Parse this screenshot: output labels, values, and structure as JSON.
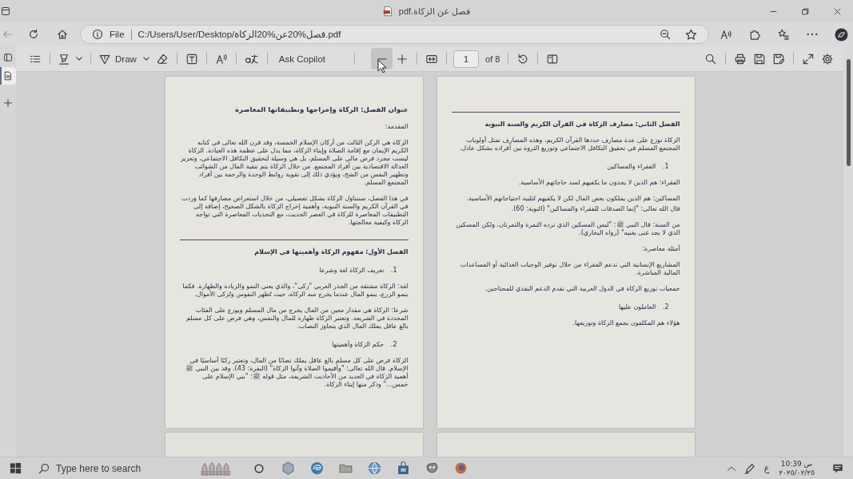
{
  "window": {
    "title": "فصل عن الزكاة.pdf"
  },
  "vertical_tabs": [
    {
      "selected": true
    }
  ],
  "address_bar": {
    "scheme": "File",
    "url": "C:/Users/User/Desktop/فصل%20عن%20الزكاة.pdf"
  },
  "pdf_toolbar": {
    "draw_label": "Draw",
    "ask_label": "Ask Copilot",
    "zoom_out_hovered": true,
    "page_number": "1",
    "page_count": "of 8"
  },
  "pages": [
    {
      "blocks": [
        {
          "kind": "title",
          "text": "عنوان الفصل: الزكاة وإخراجها وتطبيقاتها المعاصرة"
        },
        {
          "kind": "label",
          "text": "المقدمة:"
        },
        {
          "kind": "paragraph",
          "text": "الزكاة هي الركن الثالث من أركان الإسلام الخمسة، وقد قرن الله تعالى في كتابه الكريم الإيمان مع إقامة الصلاة وإيتاء الزكاة، مما يدل على عظمة هذه العبادة. الزكاة ليست مجرد فرض مالي على المسلم، بل هي وسيلة لتحقيق التكافل الاجتماعي، وتعزيز العدالة الاقتصادية بين أفراد المجتمع. من خلال الزكاة يتم تنقية المال من الشوائب وتطهير النفس من الشح، ويؤدي ذلك إلى تقوية روابط الوحدة والرحمة بين أفراد المجتمع المسلم."
        },
        {
          "kind": "paragraph",
          "text": "في هذا الفصل، سنتناول الزكاة بشكل تفصيلي، من خلال استعراض مصارفها كما وردت في القرآن الكريم والسنة النبوية، وأهمية إخراج الزكاة بالشكل الصحيح، إضافة إلى التطبيقات المعاصرة للزكاة في العصر الحديث، مع التحديات المعاصرة التي تواجه الزكاة وكيفية معالجتها."
        },
        {
          "kind": "rule"
        },
        {
          "kind": "heading",
          "text": "الفصل الأول: مفهوم الزكاة وأهميتها في الإسلام"
        },
        {
          "kind": "numbered",
          "number": "1.",
          "text": "تعريف الزكاة لغة وشرعا"
        },
        {
          "kind": "paragraph",
          "text": "لغة: الزكاة مشتقة من الجذر العربي \"زكى\"، والذي يعني النمو والزيادة والطهارة. فكما ينمو الزرع، ينمو المال عندما يخرج منه الزكاة، حيث تُطهر النفوس وتُزكى الأموال."
        },
        {
          "kind": "paragraph",
          "text": "شرعا: الزكاة هي مقدار معين من المال يخرج من مال المسلم ويوزع على الفئات المحددة في الشريعة. وتعتبر الزكاة طهارة للمال والنفس، وهي فرض على كل مسلم بالغ عاقل يملك المال الذي يتجاوز النصاب."
        },
        {
          "kind": "numbered",
          "number": "2.",
          "text": "حكم الزكاة وأهميتها"
        },
        {
          "kind": "paragraph",
          "text": "الزكاة فرض على كل مسلم بالغ عاقل يملك نصابًا من المال، وتعتبر ركنًا أساسيًا في الإسلام. قال الله تعالى: \"وأقيموا الصلاة وآتوا الزكاة\" (البقرة: 43). وقد بين النبي ﷺ أهمية الزكاة في العديد من الأحاديث الشريفة، مثل قوله ﷺ: \"بني الإسلام على خمس...\" وذكر منها إيتاء الزكاة."
        }
      ]
    },
    {
      "blocks": [
        {
          "kind": "rule"
        },
        {
          "kind": "heading",
          "text": "الفصل الثاني: مصارف الزكاة في القرآن الكريم والسنة النبوية"
        },
        {
          "kind": "paragraph",
          "text": "الزكاة توزع على عدة مصارف حددها القرآن الكريم، وهذه المصارف تمثل أولويات المجتمع المسلم في تحقيق التكافل الاجتماعي وتوزيع الثروة بين أفراده بشكل عادل."
        },
        {
          "kind": "numbered",
          "number": "1.",
          "text": "الفقراء والمساكين"
        },
        {
          "kind": "paragraph",
          "text": "الفقراء: هم الذين لا يجدون ما يكفيهم لسد حاجاتهم الأساسية."
        },
        {
          "kind": "paragraph",
          "text": "المساكين: هم الذين يملكون بعض المال لكن لا يكفيهم لتلبية احتياجاتهم الأساسية."
        },
        {
          "kind": "line",
          "text": "قال الله تعالى: \"إنما الصدقات للفقراء والمساكين\" (التوبة: 60)."
        },
        {
          "kind": "paragraph",
          "text": "من السنة: قال النبي ﷺ: \"ليس المسكين الذي ترده التمرة والتمرتان، ولكن المسكين الذي لا يجد غنى يغنيه\" (رواه البخاري)."
        },
        {
          "kind": "paragraph",
          "text": "أمثلة معاصرة:"
        },
        {
          "kind": "paragraph",
          "text": "المشاريع الإنسانية التي تدعم الفقراء من خلال توفير الوجبات الغذائية أو المساعدات المالية المباشرة."
        },
        {
          "kind": "paragraph",
          "text": "جمعيات توزيع الزكاة في الدول العربية التي تقدم الدعم النقدي للمحتاجين."
        },
        {
          "kind": "numbered",
          "number": "2.",
          "text": "العاملون عليها"
        },
        {
          "kind": "paragraph",
          "text": "هؤلاء هم المكلفون بجمع الزكاة وتوزيعها."
        }
      ]
    }
  ],
  "taskbar": {
    "search_placeholder": "Type here to search",
    "input_language": "ع",
    "time": "10:39 ص",
    "date": "٢٠٢٥/٠٢/٢٥"
  }
}
